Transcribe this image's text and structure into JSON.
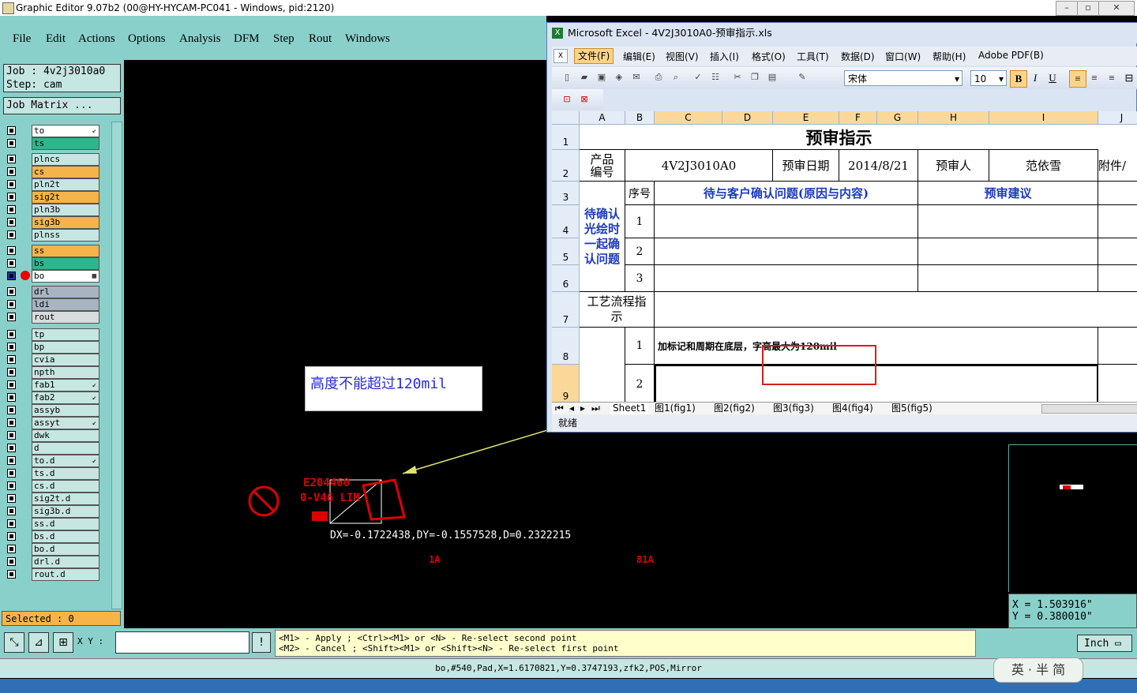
{
  "ge": {
    "title": "Graphic Editor 9.07b2 (00@HY-HYCAM-PC041 - Windows, pid:2120)",
    "menu": [
      "File",
      "Edit",
      "Actions",
      "Options",
      "Analysis",
      "DFM",
      "Step",
      "Rout",
      "Windows"
    ],
    "job": "Job : 4v2j3010a0",
    "step": "Step: cam",
    "job_matrix": "Job Matrix ...",
    "layers": [
      {
        "name": "to",
        "color": "#ffffff",
        "edit": "↙"
      },
      {
        "name": "ts",
        "color": "#2fb58c",
        "edit": ""
      },
      {
        "name": "plncs",
        "color": "#c6e6e2",
        "edit": ""
      },
      {
        "name": "cs",
        "color": "#f5b44a",
        "edit": ""
      },
      {
        "name": "pln2t",
        "color": "#c6e6e2",
        "edit": ""
      },
      {
        "name": "sig2t",
        "color": "#f5b44a",
        "edit": ""
      },
      {
        "name": "pln3b",
        "color": "#c6e6e2",
        "edit": ""
      },
      {
        "name": "sig3b",
        "color": "#f5b44a",
        "edit": ""
      },
      {
        "name": "plnss",
        "color": "#c6e6e2",
        "edit": ""
      },
      {
        "name": "ss",
        "color": "#f5b44a",
        "edit": ""
      },
      {
        "name": "bs",
        "color": "#2fb58c",
        "edit": ""
      },
      {
        "name": "bo",
        "color": "#ffffff",
        "edit": "▦"
      },
      {
        "name": "drl",
        "color": "#a8b4c0",
        "edit": ""
      },
      {
        "name": "ldi",
        "color": "#a8b4c0",
        "edit": ""
      },
      {
        "name": "rout",
        "color": "#d8dcdc",
        "edit": ""
      },
      {
        "name": "tp",
        "color": "#c6e6e2",
        "edit": ""
      },
      {
        "name": "bp",
        "color": "#c6e6e2",
        "edit": ""
      },
      {
        "name": "cvia",
        "color": "#c6e6e2",
        "edit": ""
      },
      {
        "name": "npth",
        "color": "#c6e6e2",
        "edit": ""
      },
      {
        "name": "fab1",
        "color": "#c6e6e2",
        "edit": "↙"
      },
      {
        "name": "fab2",
        "color": "#c6e6e2",
        "edit": "↙"
      },
      {
        "name": "assyb",
        "color": "#c6e6e2",
        "edit": ""
      },
      {
        "name": "assyt",
        "color": "#c6e6e2",
        "edit": "↙"
      },
      {
        "name": "dwk",
        "color": "#c6e6e2",
        "edit": ""
      },
      {
        "name": "d",
        "color": "#c6e6e2",
        "edit": ""
      },
      {
        "name": "to.d",
        "color": "#c6e6e2",
        "edit": "↙"
      },
      {
        "name": "ts.d",
        "color": "#c6e6e2",
        "edit": ""
      },
      {
        "name": "cs.d",
        "color": "#c6e6e2",
        "edit": ""
      },
      {
        "name": "sig2t.d",
        "color": "#c6e6e2",
        "edit": ""
      },
      {
        "name": "sig3b.d",
        "color": "#c6e6e2",
        "edit": ""
      },
      {
        "name": "ss.d",
        "color": "#c6e6e2",
        "edit": ""
      },
      {
        "name": "bs.d",
        "color": "#c6e6e2",
        "edit": ""
      },
      {
        "name": "bo.d",
        "color": "#c6e6e2",
        "edit": ""
      },
      {
        "name": "drl.d",
        "color": "#c6e6e2",
        "edit": ""
      },
      {
        "name": "rout.d",
        "color": "#c6e6e2",
        "edit": ""
      }
    ],
    "selected": "Selected : 0",
    "xy_label": "X Y :",
    "xy_value": "",
    "msg_line1": "<M1> - Apply  ; <Ctrl><M1> or <N> - Re-select second point",
    "msg_line2": "<M2> - Cancel ; <Shift><M1> or <Shift><N> - Re-select first point",
    "unit": "Inch",
    "status": "bo,#540,Pad,X=1.6170821,Y=0.3747193,zfk2,POS,Mirror",
    "coord_x": "X = 1.503916\"",
    "coord_y": "Y = 0.380010\"",
    "measure": "DX=-0.1722438,DY=-0.1557528,D=0.2322215",
    "annotation": "高度不能超过120mil",
    "board_lbl1": "1A",
    "board_lbl2": "81A",
    "board_text1": "E204460",
    "board_text2": "0-V46 LIM",
    "ime": "英 · 半 简"
  },
  "xl": {
    "title": "Microsoft Excel - 4V2J3010A0-预审指示.xls",
    "menu": [
      "文件(F)",
      "编辑(E)",
      "视图(V)",
      "插入(I)",
      "格式(O)",
      "工具(T)",
      "数据(D)",
      "窗口(W)",
      "帮助(H)",
      "Adobe PDF(B)"
    ],
    "font": "宋体",
    "size": "10",
    "cols": [
      "A",
      "B",
      "C",
      "D",
      "E",
      "F",
      "G",
      "H",
      "I",
      "J"
    ],
    "rows": [
      "1",
      "2",
      "3",
      "4",
      "5",
      "6",
      "7",
      "8",
      "9"
    ],
    "c_title": "预审指示",
    "c_prod": "产品编号",
    "c_prodval": "4V2J3010A0",
    "c_date_lbl": "预审日期",
    "c_date": "2014/8/21",
    "c_person_lbl": "预审人",
    "c_person": "范依雪",
    "c_attach": "附件/",
    "c_seq": "序号",
    "c_issue": "待与客户确认问题(原因与内容)",
    "c_advice": "预审建议",
    "c_confirm": "待确认光绘时一起确认问题",
    "c_n1": "1",
    "c_n2": "2",
    "c_n3": "3",
    "c_process": "工艺流程指示",
    "c_p1": "1",
    "c_p1_text": "加标记和周期在底层，字高最大为120mil",
    "c_p2": "2",
    "tabs": [
      "Sheet1",
      "图1(fig1)",
      "图2(fig2)",
      "图3(fig3)",
      "图4(fig4)",
      "图5(fig5)"
    ],
    "status": "就绪"
  },
  "colors": {
    "teal": "#8ad0ca",
    "orange": "#f5b44a",
    "green": "#2fb58c",
    "red": "#dd0000",
    "blue": "#1d39c4"
  }
}
